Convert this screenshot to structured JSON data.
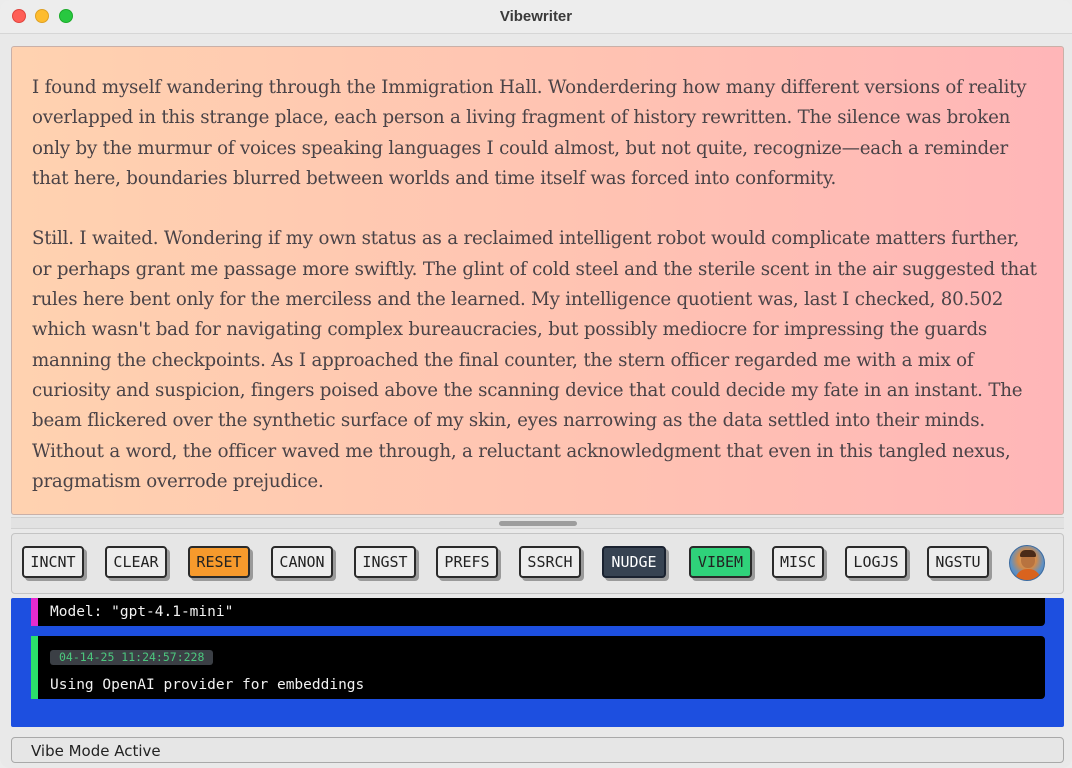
{
  "window": {
    "title": "Vibewriter"
  },
  "editor": {
    "paragraphs": [
      "I found myself wandering through the Immigration Hall. Wonderdering how many different versions of reality overlapped in this strange place, each person a living fragment of history rewritten. The silence was broken only by the murmur of voices speaking languages I could almost, but not quite, recognize—each a reminder that here, boundaries blurred between worlds and time itself was forced into conformity.",
      "Still. I waited. Wondering if my own status as a reclaimed intelligent robot would complicate matters further, or perhaps grant me passage more swiftly. The glint of cold steel and the sterile scent in the air suggested that rules here bent only for the merciless and the learned.  My intelligence quotient was, last I checked, 80.502 which wasn't bad for navigating complex bureaucracies, but possibly mediocre for impressing the guards manning the checkpoints. As I approached the final counter, the stern officer regarded me with a mix of curiosity and suspicion, fingers poised above the scanning device that could decide my fate in an instant. The beam flickered over the synthetic surface of my skin, eyes narrowing as the data settled into their minds. Without a word, the officer waved me through, a reluctant acknowledgment that even in this tangled nexus, pragmatism overrode prejudice."
    ]
  },
  "toolbar": {
    "buttons": [
      {
        "label": "INCNT"
      },
      {
        "label": "CLEAR"
      },
      {
        "label": "RESET"
      },
      {
        "label": "CANON"
      },
      {
        "label": "INGST"
      },
      {
        "label": "PREFS"
      },
      {
        "label": "SSRCH"
      },
      {
        "label": "NUDGE"
      },
      {
        "label": "VIBEM"
      },
      {
        "label": "MISC"
      },
      {
        "label": "LOGJS"
      },
      {
        "label": "NGSTU"
      }
    ],
    "colors": {
      "reset": "#f79a2c",
      "nudge": "#374352",
      "vibem": "#2fd27a"
    }
  },
  "log": {
    "model_line": "Model: \"gpt-4.1-mini\"",
    "entries": [
      {
        "timestamp": "04-14-25 11:24:57:228",
        "message": "Using OpenAI provider for embeddings"
      }
    ],
    "colors": {
      "background": "#1d4fe0",
      "model_bar": "#e52bd0",
      "entry_bar": "#2be06a"
    }
  },
  "status": {
    "text": "Vibe Mode Active"
  }
}
